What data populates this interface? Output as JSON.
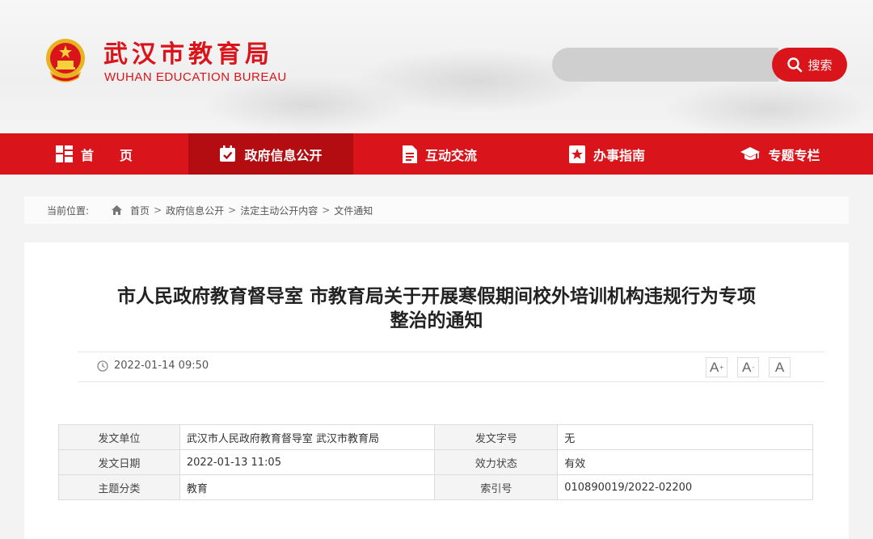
{
  "header": {
    "logo_cn": "武汉市教育局",
    "logo_en": "WUHAN EDUCATION BUREAU",
    "search_placeholder": "",
    "search_label": "搜索"
  },
  "nav": {
    "items": [
      {
        "label": "首　　页",
        "icon": "home-grid-icon"
      },
      {
        "label": "政府信息公开",
        "icon": "calendar-check-icon"
      },
      {
        "label": "互动交流",
        "icon": "document-icon"
      },
      {
        "label": "办事指南",
        "icon": "bookmark-star-icon"
      },
      {
        "label": "专题专栏",
        "icon": "graduation-cap-icon"
      }
    ],
    "active_index": 1
  },
  "breadcrumb": {
    "label": "当前位置:",
    "items": [
      "首页",
      "政府信息公开",
      "法定主动公开内容",
      "文件通知"
    ]
  },
  "article": {
    "title_line1": "市人民政府教育督导室 市教育局关于开展寒假期间校外培训机构违规行为专项",
    "title_line2": "整治的通知",
    "datetime": "2022-01-14 09:50",
    "font_sizes": [
      "A+",
      "A",
      "A"
    ]
  },
  "info": {
    "rows": [
      {
        "k1": "发文单位",
        "v1": "武汉市人民政府教育督导室 武汉市教育局",
        "k2": "发文字号",
        "v2": "无"
      },
      {
        "k1": "发文日期",
        "v1": "2022-01-13 11:05",
        "k2": "效力状态",
        "v2": "有效"
      },
      {
        "k1": "主题分类",
        "v1": "教育",
        "k2": "索引号",
        "v2": "010890019/2022-02200"
      }
    ]
  },
  "colors": {
    "brand_red": "#d9141a",
    "nav_active": "#b30d12"
  }
}
